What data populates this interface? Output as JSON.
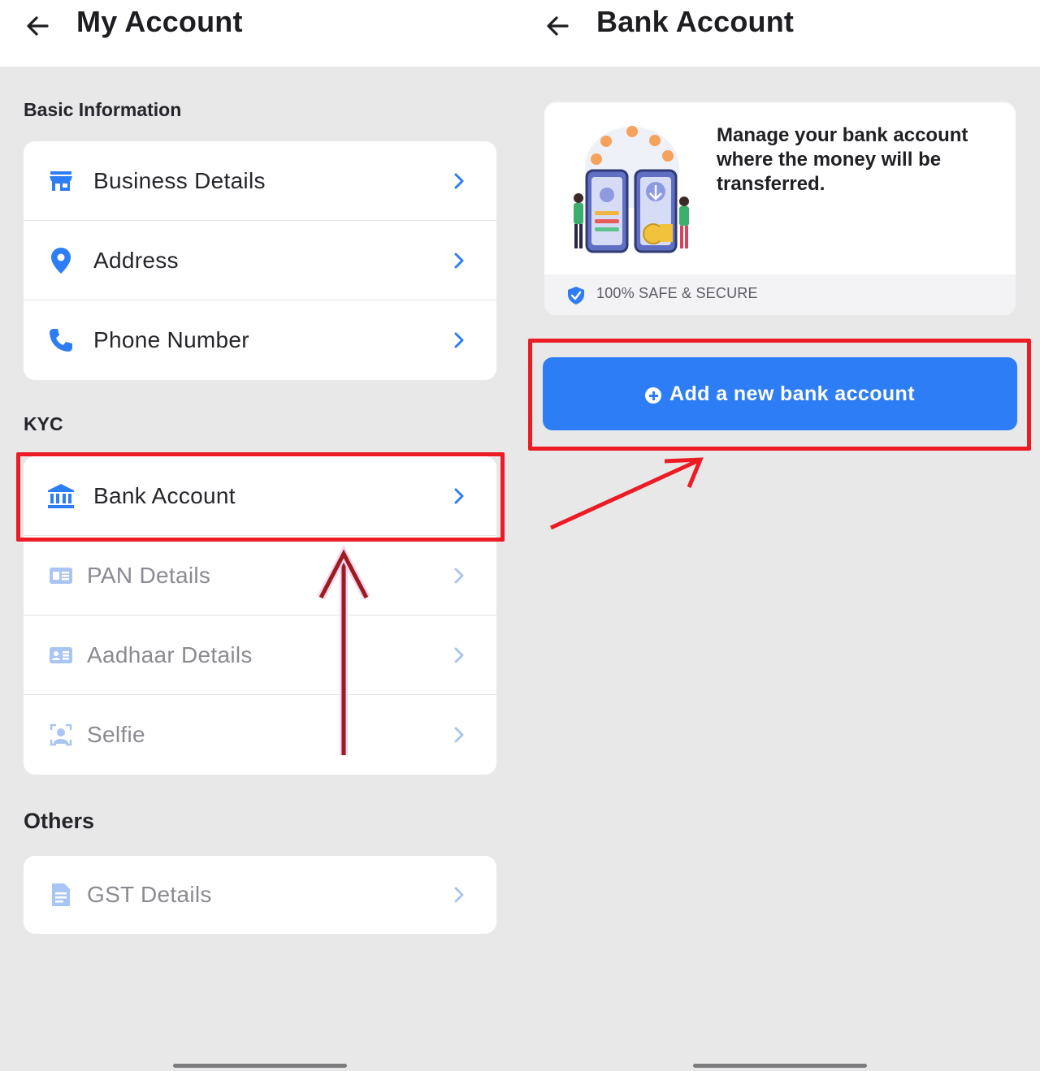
{
  "left_screen": {
    "title": "My Account",
    "sections": {
      "basic": {
        "label": "Basic Information",
        "items": [
          {
            "label": "Business Details",
            "icon": "store-icon"
          },
          {
            "label": "Address",
            "icon": "location-pin-icon"
          },
          {
            "label": "Phone Number",
            "icon": "phone-icon"
          }
        ]
      },
      "kyc": {
        "label": "KYC",
        "items": [
          {
            "label": "Bank Account",
            "icon": "bank-icon"
          },
          {
            "label": "PAN Details",
            "icon": "id-card-icon"
          },
          {
            "label": "Aadhaar Details",
            "icon": "id-card-icon"
          },
          {
            "label": "Selfie",
            "icon": "selfie-icon"
          }
        ]
      },
      "others": {
        "label": "Others",
        "items": [
          {
            "label": "GST Details",
            "icon": "document-icon"
          }
        ]
      }
    }
  },
  "right_screen": {
    "title": "Bank Account",
    "info_card": {
      "message": "Manage your bank account where the money will be transferred.",
      "security_note": "100% SAFE & SECURE"
    },
    "add_button": {
      "label": "Add a new bank account"
    }
  },
  "colors": {
    "accent": "#2d7df6",
    "highlight": "#ec1b24",
    "arrow_dark": "#9b1c1c",
    "background": "#e8e8e9"
  }
}
